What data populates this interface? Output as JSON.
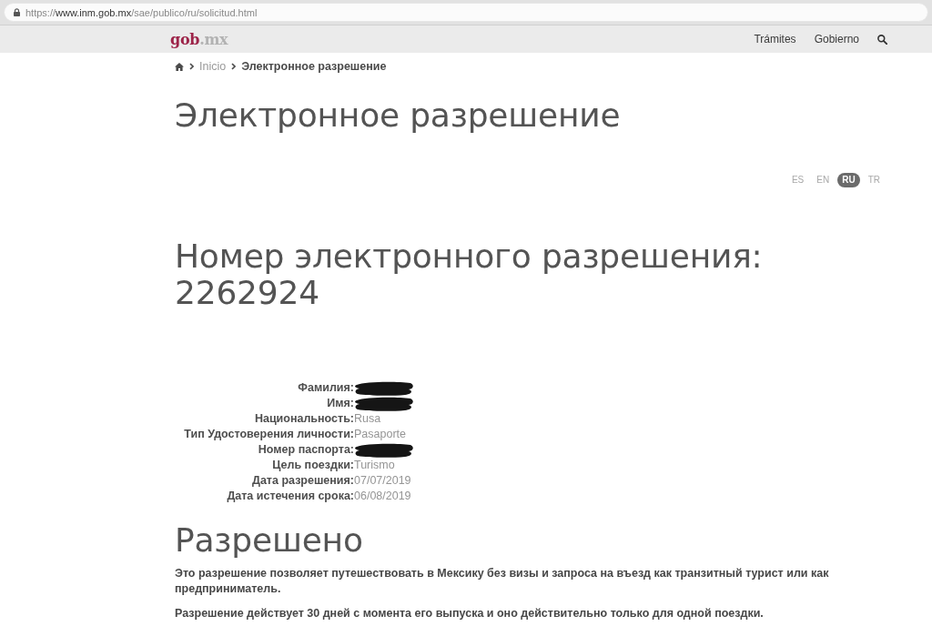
{
  "browser": {
    "url": {
      "scheme": "https://",
      "host": "www.inm.gob.mx",
      "path": "/sae/publico/ru/solicitud.html"
    }
  },
  "header": {
    "logo": {
      "name": "gob",
      "suffix": ".mx"
    },
    "nav": [
      "Trámites",
      "Gobierno"
    ]
  },
  "breadcrumb": [
    {
      "label": "Inicio",
      "current": false
    },
    {
      "label": "Электронное разрешение",
      "current": true
    }
  ],
  "title": "Электронное разрешение",
  "languages": [
    {
      "label": "ES",
      "selected": false
    },
    {
      "label": "EN",
      "selected": false
    },
    {
      "label": "RU",
      "selected": true
    },
    {
      "label": "TR",
      "selected": false
    }
  ],
  "permit": {
    "heading": "Номер электронного разрешения:",
    "number": "2262924"
  },
  "fields": [
    {
      "label": "Фамилия:",
      "redacted": true
    },
    {
      "label": "Имя:",
      "redacted": true
    },
    {
      "label": "Национальность:",
      "value": "Rusa",
      "redacted": false
    },
    {
      "label": "Тип Удостоверения личности:",
      "value": "Pasaporte",
      "redacted": false
    },
    {
      "label": "Номер паспорта:",
      "redacted": true
    },
    {
      "label": "Цель поездки:",
      "value": "Turismo",
      "redacted": false
    },
    {
      "label": "Дата разрешения:",
      "value": "07/07/2019",
      "redacted": false
    },
    {
      "label": "Дата истечения срока:",
      "value": "06/08/2019",
      "redacted": false
    }
  ],
  "status": {
    "title": "Разрешено",
    "paragraphs": [
      "Это разрешение позволяет путешествовать в Мексику без визы и запроса на въезд как транзитный турист или как предприниматель.",
      "Разрешение действует 30 дней с момента его выпуска и оно действительно только для одной поездки."
    ]
  }
}
